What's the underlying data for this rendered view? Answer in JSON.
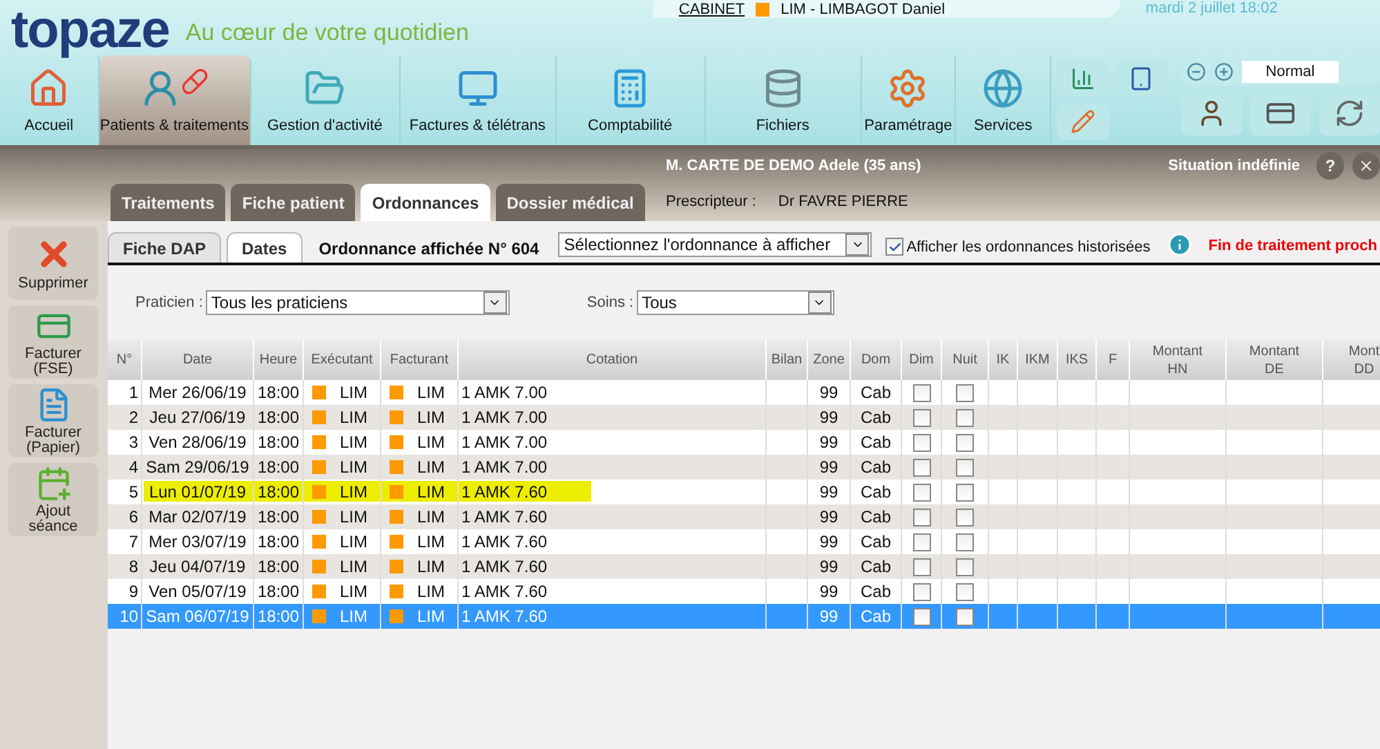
{
  "header": {
    "logo": "topaze",
    "tagline": "Au cœur de votre quotidien",
    "cabinet_link": "CABINET",
    "practitioner": {
      "name": "LIM - LIMBAGOT Daniel",
      "color": "#ff9900"
    },
    "datetime": "mardi 2 juillet 18:02"
  },
  "nav": [
    {
      "label": "Accueil",
      "selected": false
    },
    {
      "label": "Patients & traitements",
      "selected": true
    },
    {
      "label": "Gestion d'activité",
      "selected": false
    },
    {
      "label": "Factures & télétrans",
      "selected": false
    },
    {
      "label": "Comptabilité",
      "selected": false
    },
    {
      "label": "Fichiers",
      "selected": false
    },
    {
      "label": "Paramétrage",
      "selected": false
    },
    {
      "label": "Services",
      "selected": false
    }
  ],
  "zoom": {
    "value": "Normal"
  },
  "patient": {
    "name": "M. CARTE DE DEMO Adele (35 ans)",
    "situation": "Situation indéfinie",
    "help": "?",
    "prescriber_label": "Prescripteur :",
    "prescriber": "Dr FAVRE PIERRE"
  },
  "tabs": [
    {
      "label": "Traitements",
      "selected": false
    },
    {
      "label": "Fiche patient",
      "selected": false
    },
    {
      "label": "Ordonnances",
      "selected": true
    },
    {
      "label": "Dossier médical",
      "selected": false
    }
  ],
  "sidebar": [
    "Supprimer",
    "Facturer (FSE)",
    "Facturer (Papier)",
    "Ajout séance"
  ],
  "subtabs": [
    {
      "label": "Fiche DAP",
      "selected": false
    },
    {
      "label": "Dates",
      "selected": true
    }
  ],
  "ordonnance_title": "Ordonnance affichée N° 604",
  "ordonnance_select": "Sélectionnez l'ordonnance à afficher",
  "history_checkbox": {
    "label": "Afficher les ordonnances historisées",
    "checked": true
  },
  "alert": "Fin de traitement proch",
  "filters": [
    {
      "label": "Praticien :",
      "value": "Tous les praticiens"
    },
    {
      "label": "Soins :",
      "value": "Tous"
    }
  ],
  "table": {
    "columns": [
      [
        "N°"
      ],
      [
        "Date"
      ],
      [
        "Heure"
      ],
      [
        "Exécutant"
      ],
      [
        "Facturant"
      ],
      [
        "Cotation"
      ],
      [
        "Bilan"
      ],
      [
        "Zone"
      ],
      [
        "Dom"
      ],
      [
        "Dim"
      ],
      [
        "Nuit"
      ],
      [
        "IK"
      ],
      [
        "IKM"
      ],
      [
        "IKS"
      ],
      [
        "F"
      ],
      [
        "Montant",
        "HN"
      ],
      [
        "Montant",
        "DE"
      ],
      [
        "Mont",
        "DD"
      ]
    ],
    "rows": [
      {
        "n": "1",
        "date": "Mer 26/06/19",
        "time": "18:00",
        "executant": {
          "name": "LIM",
          "color": "#ff9900"
        },
        "facturant": {
          "name": "LIM",
          "color": "#ff9900"
        },
        "cotation": "1 AMK 7.00",
        "zone": "99",
        "dom": "Cab",
        "dim": false,
        "nuit": false,
        "selected": false,
        "marked": false
      },
      {
        "n": "2",
        "date": "Jeu 27/06/19",
        "time": "18:00",
        "executant": {
          "name": "LIM",
          "color": "#ff9900"
        },
        "facturant": {
          "name": "LIM",
          "color": "#ff9900"
        },
        "cotation": "1 AMK 7.00",
        "zone": "99",
        "dom": "Cab",
        "dim": false,
        "nuit": false,
        "selected": false,
        "marked": false
      },
      {
        "n": "3",
        "date": "Ven 28/06/19",
        "time": "18:00",
        "executant": {
          "name": "LIM",
          "color": "#ff9900"
        },
        "facturant": {
          "name": "LIM",
          "color": "#ff9900"
        },
        "cotation": "1 AMK 7.00",
        "zone": "99",
        "dom": "Cab",
        "dim": false,
        "nuit": false,
        "selected": false,
        "marked": false
      },
      {
        "n": "4",
        "date": "Sam 29/06/19",
        "time": "18:00",
        "executant": {
          "name": "LIM",
          "color": "#ff9900"
        },
        "facturant": {
          "name": "LIM",
          "color": "#ff9900"
        },
        "cotation": "1 AMK 7.00",
        "zone": "99",
        "dom": "Cab",
        "dim": false,
        "nuit": false,
        "selected": false,
        "marked": false
      },
      {
        "n": "5",
        "date": "Lun 01/07/19",
        "time": "18:00",
        "executant": {
          "name": "LIM",
          "color": "#ff9900"
        },
        "facturant": {
          "name": "LIM",
          "color": "#ff9900"
        },
        "cotation": "1 AMK 7.60",
        "zone": "99",
        "dom": "Cab",
        "dim": false,
        "nuit": false,
        "selected": false,
        "marked": true
      },
      {
        "n": "6",
        "date": "Mar 02/07/19",
        "time": "18:00",
        "executant": {
          "name": "LIM",
          "color": "#ff9900"
        },
        "facturant": {
          "name": "LIM",
          "color": "#ff9900"
        },
        "cotation": "1 AMK 7.60",
        "zone": "99",
        "dom": "Cab",
        "dim": false,
        "nuit": false,
        "selected": false,
        "marked": false
      },
      {
        "n": "7",
        "date": "Mer 03/07/19",
        "time": "18:00",
        "executant": {
          "name": "LIM",
          "color": "#ff9900"
        },
        "facturant": {
          "name": "LIM",
          "color": "#ff9900"
        },
        "cotation": "1 AMK 7.60",
        "zone": "99",
        "dom": "Cab",
        "dim": false,
        "nuit": false,
        "selected": false,
        "marked": false
      },
      {
        "n": "8",
        "date": "Jeu 04/07/19",
        "time": "18:00",
        "executant": {
          "name": "LIM",
          "color": "#ff9900"
        },
        "facturant": {
          "name": "LIM",
          "color": "#ff9900"
        },
        "cotation": "1 AMK 7.60",
        "zone": "99",
        "dom": "Cab",
        "dim": false,
        "nuit": false,
        "selected": false,
        "marked": false
      },
      {
        "n": "9",
        "date": "Ven 05/07/19",
        "time": "18:00",
        "executant": {
          "name": "LIM",
          "color": "#ff9900"
        },
        "facturant": {
          "name": "LIM",
          "color": "#ff9900"
        },
        "cotation": "1 AMK 7.60",
        "zone": "99",
        "dom": "Cab",
        "dim": false,
        "nuit": false,
        "selected": false,
        "marked": false
      },
      {
        "n": "10",
        "date": "Sam 06/07/19",
        "time": "18:00",
        "executant": {
          "name": "LIM",
          "color": "#ff9900"
        },
        "facturant": {
          "name": "LIM",
          "color": "#ff9900"
        },
        "cotation": "1 AMK 7.60",
        "zone": "99",
        "dom": "Cab",
        "dim": false,
        "nuit": false,
        "selected": true,
        "marked": false
      }
    ]
  }
}
